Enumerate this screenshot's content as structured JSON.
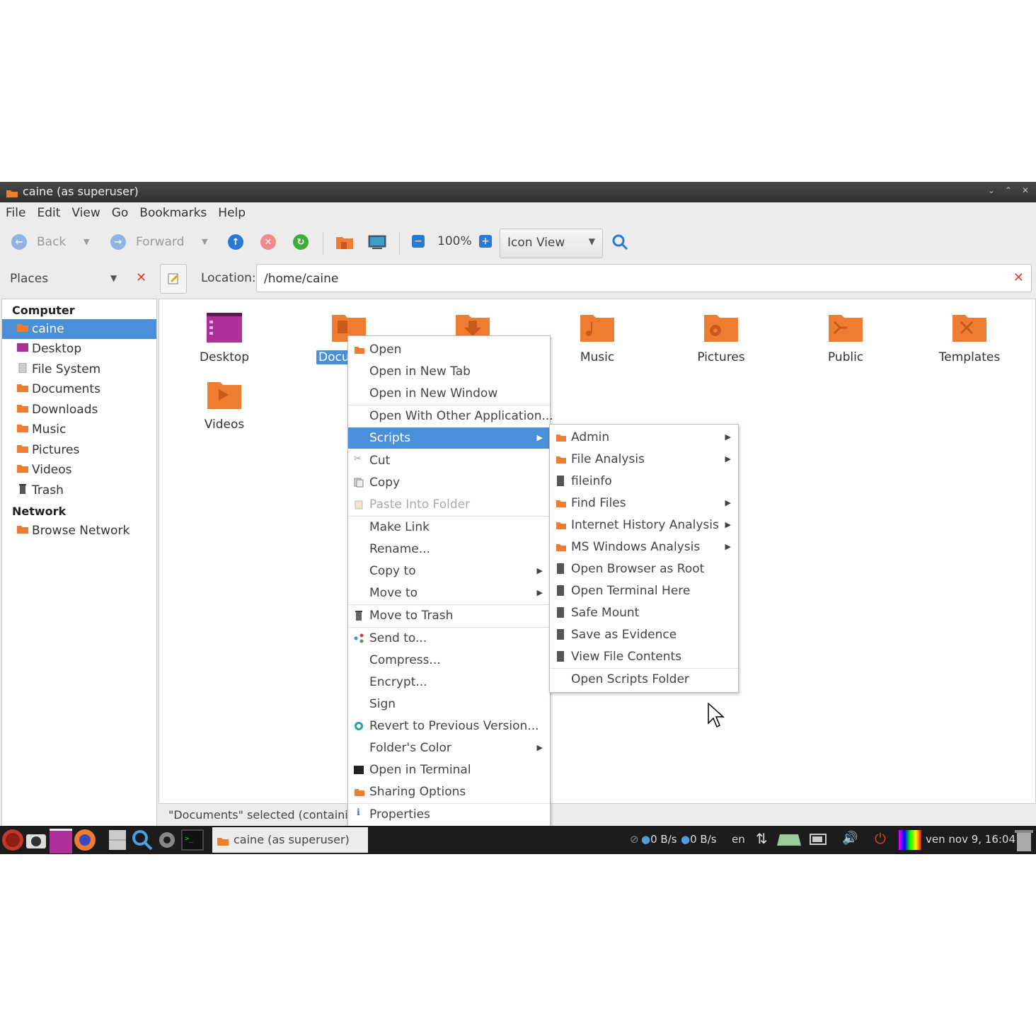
{
  "window": {
    "title": "caine (as superuser)"
  },
  "menubar": [
    "File",
    "Edit",
    "View",
    "Go",
    "Bookmarks",
    "Help"
  ],
  "toolbar": {
    "back": "Back",
    "forward": "Forward",
    "zoom": "100%",
    "view_mode": "Icon View"
  },
  "places": {
    "header": "Places"
  },
  "location": {
    "label": "Location:",
    "value": "/home/caine"
  },
  "sidebar": {
    "computer_header": "Computer",
    "network_header": "Network",
    "items": [
      "caine",
      "Desktop",
      "File System",
      "Documents",
      "Downloads",
      "Music",
      "Pictures",
      "Videos",
      "Trash"
    ],
    "network_items": [
      "Browse Network"
    ]
  },
  "files": [
    "Desktop",
    "Docu",
    "Music",
    "Pictures",
    "Public",
    "Templates",
    "Videos"
  ],
  "status": "\"Documents\" selected (containing",
  "context_menu": [
    "Open",
    "Open in New Tab",
    "Open in New Window",
    "Open With Other Application...",
    "Scripts",
    "Cut",
    "Copy",
    "Paste Into Folder",
    "Make Link",
    "Rename...",
    "Copy to",
    "Move to",
    "Move to Trash",
    "Send to...",
    "Compress...",
    "Encrypt...",
    "Sign",
    "Revert to Previous Version...",
    "Folder's Color",
    "Open in Terminal",
    "Sharing Options",
    "Properties"
  ],
  "scripts_menu": [
    "Admin",
    "File Analysis",
    "fileinfo",
    "Find Files",
    "Internet History Analysis",
    "MS Windows Analysis",
    "Open Browser as Root",
    "Open Terminal Here",
    "Safe Mount",
    "Save as Evidence",
    "View File Contents",
    "Open Scripts Folder"
  ],
  "taskbar": {
    "task": "caine (as superuser)",
    "net_down": "0 B/s",
    "net_up": "0 B/s",
    "lang": "en",
    "clock": "ven nov  9, 16:04"
  },
  "colors": {
    "accent": "#4a90d9",
    "folder": "#f07c32",
    "close_red": "#e53935"
  }
}
